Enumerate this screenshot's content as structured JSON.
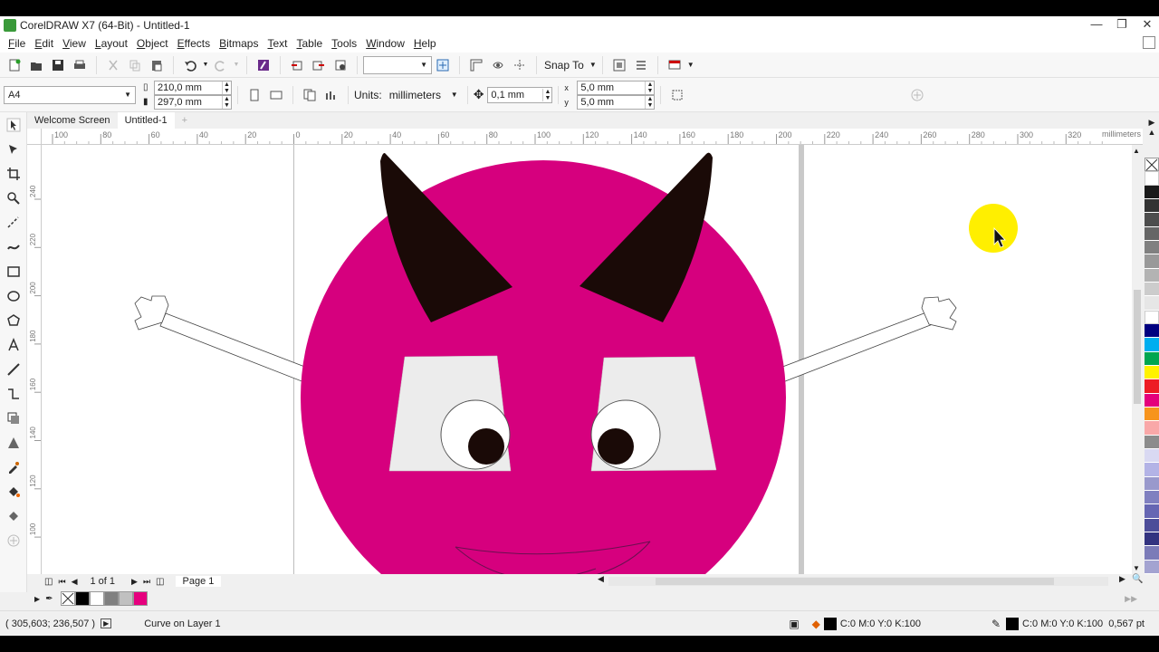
{
  "window": {
    "title": "CorelDRAW X7 (64-Bit) - Untitled-1",
    "buttons": [
      "minimize-icon",
      "restore-icon",
      "close-icon"
    ]
  },
  "menu": [
    "File",
    "Edit",
    "View",
    "Layout",
    "Object",
    "Effects",
    "Bitmaps",
    "Text",
    "Table",
    "Tools",
    "Window",
    "Help"
  ],
  "toolbar": {
    "zoom_value": "",
    "snap_to": "Snap To"
  },
  "propertybar": {
    "page_size": "A4",
    "width": "210,0 mm",
    "height": "297,0 mm",
    "units_label": "Units:",
    "units_value": "millimeters",
    "nudge": "0,1 mm",
    "dup_x": "5,0 mm",
    "dup_y": "5,0 mm"
  },
  "tabs": [
    "Welcome Screen",
    "Untitled-1"
  ],
  "active_tab": 1,
  "rulers": {
    "h_labels": [
      "100",
      "80",
      "60",
      "40",
      "20",
      "0",
      "20",
      "40",
      "60",
      "80",
      "100",
      "120",
      "140",
      "160",
      "180",
      "200",
      "220",
      "240",
      "260",
      "280",
      "300",
      "320"
    ],
    "units": "millimeters",
    "v_labels": [
      "240",
      "220",
      "200",
      "180",
      "160",
      "140",
      "120",
      "100"
    ]
  },
  "pagenav": {
    "page_count": "1 of 1",
    "page_tab": "Page 1"
  },
  "status": {
    "coords": "( 305,603; 236,507 )",
    "object": "Curve on Layer 1",
    "fill": "C:0 M:0 Y:0 K:100",
    "outline": "C:0 M:0 Y:0 K:100  0,567 pt"
  },
  "colors": {
    "devil_face": "#d6007e",
    "horn": "#1a0a07",
    "eye_white": "#ececec",
    "cursor_highlight": "#ffef00"
  },
  "palette": [
    "#ffffff",
    "#1a1a1a",
    "#333333",
    "#4d4d4d",
    "#666666",
    "#808080",
    "#999999",
    "#b3b3b3",
    "#cccccc",
    "#e6e6e6",
    "#ffffff",
    "#000080",
    "#00aeef",
    "#00a651",
    "#fff200",
    "#ed1c24",
    "#e4007c",
    "#f7941d",
    "#f9a8a8",
    "#8c8c8c",
    "#d9d9f2",
    "#b3b3e6",
    "#9999cc",
    "#8080c0",
    "#6666b3",
    "#4d4d99",
    "#333380",
    "#7b7bb8",
    "#a3a3d1"
  ],
  "doc_palette": [
    "#000000",
    "#ffffff",
    "#808080",
    "#c0c0c0",
    "#e6007e"
  ]
}
